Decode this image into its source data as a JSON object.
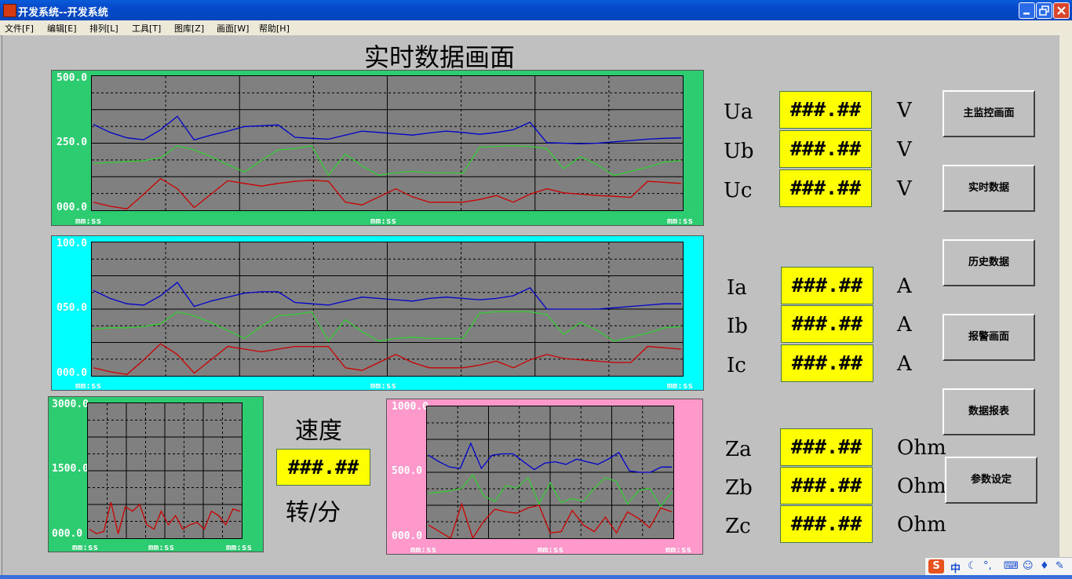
{
  "window": {
    "title": "开发系统--开发系统"
  },
  "menu": {
    "items": [
      "文件[F]",
      "编辑[E]",
      "排列[L]",
      "工具[T]",
      "图库[Z]",
      "画面[W]",
      "帮助[H]"
    ]
  },
  "screen_title": "实时数据画面",
  "colors": {
    "panel_green": "#2ecc71",
    "panel_cyan": "#00ffff",
    "panel_pink": "#ff99cc",
    "plot_bg": "#808080",
    "value_bg": "#ffff00",
    "series_blue": "#0000cc",
    "series_green": "#33cc33",
    "series_red": "#cc0000"
  },
  "chart_data": [
    {
      "type": "line",
      "ylim": [
        0,
        500
      ],
      "y_ticks": [
        "500.0",
        "250.0",
        "000.0"
      ],
      "x_ticks": [
        "mm:ss",
        "mm:ss",
        "mm:ss"
      ],
      "series": [
        {
          "color": "#0000cc",
          "values": [
            320,
            290,
            270,
            263,
            300,
            350,
            262,
            280,
            295,
            312,
            315,
            318,
            272,
            268,
            265,
            280,
            295,
            290,
            285,
            280,
            288,
            295,
            290,
            283,
            290,
            300,
            328,
            252,
            250,
            248,
            250,
            255,
            260,
            265,
            268,
            270
          ]
        },
        {
          "color": "#33cc33",
          "values": [
            175,
            178,
            182,
            185,
            195,
            240,
            225,
            200,
            170,
            142,
            185,
            225,
            230,
            240,
            130,
            210,
            165,
            130,
            140,
            145,
            140,
            140,
            138,
            235,
            238,
            240,
            238,
            230,
            155,
            200,
            170,
            130,
            145,
            160,
            180,
            185
          ]
        },
        {
          "color": "#cc0000",
          "values": [
            30,
            15,
            5,
            60,
            118,
            80,
            10,
            60,
            110,
            100,
            90,
            100,
            108,
            112,
            108,
            30,
            20,
            50,
            80,
            50,
            30,
            30,
            30,
            40,
            55,
            30,
            60,
            80,
            65,
            60,
            55,
            52,
            48,
            108,
            104,
            100
          ]
        }
      ]
    },
    {
      "type": "line",
      "ylim": [
        0,
        100
      ],
      "y_ticks": [
        "100.0",
        "050.0",
        "000.0"
      ],
      "x_ticks": [
        "mm:ss",
        "mm:ss",
        "mm:ss"
      ],
      "series": [
        {
          "color": "#0000cc",
          "values": [
            64,
            58,
            54,
            53,
            60,
            70,
            52,
            56,
            59,
            62,
            63,
            63,
            55,
            54,
            53,
            56,
            59,
            58,
            57,
            56,
            58,
            59,
            58,
            57,
            58,
            60,
            66,
            50,
            50,
            50,
            50,
            51,
            52,
            53,
            54,
            54
          ]
        },
        {
          "color": "#33cc33",
          "values": [
            35,
            36,
            36,
            37,
            39,
            48,
            45,
            40,
            34,
            28,
            37,
            45,
            46,
            48,
            26,
            42,
            33,
            26,
            28,
            29,
            28,
            28,
            28,
            47,
            48,
            48,
            48,
            46,
            31,
            40,
            34,
            26,
            29,
            32,
            36,
            37
          ]
        },
        {
          "color": "#cc0000",
          "values": [
            6,
            3,
            1,
            12,
            24,
            16,
            2,
            12,
            22,
            20,
            18,
            20,
            22,
            22,
            22,
            6,
            4,
            10,
            16,
            10,
            6,
            6,
            6,
            8,
            11,
            6,
            12,
            16,
            13,
            12,
            11,
            10,
            10,
            22,
            21,
            20
          ]
        }
      ]
    },
    {
      "type": "line",
      "ylim": [
        0,
        3000
      ],
      "y_ticks": [
        "3000.0",
        "1500.0",
        "000.0"
      ],
      "x_ticks": [
        "mm:ss",
        "mm:ss",
        "mm:ss"
      ],
      "series": [
        {
          "color": "#cc0000",
          "values": [
            200,
            100,
            150,
            800,
            100,
            700,
            600,
            750,
            300,
            200,
            600,
            300,
            500,
            200,
            300,
            350,
            200,
            600,
            500,
            300,
            650,
            600
          ]
        }
      ]
    },
    {
      "type": "line",
      "ylim": [
        0,
        1000
      ],
      "y_ticks": [
        "1000.0",
        "500.0",
        "000.0"
      ],
      "x_ticks": [
        "mm:ss",
        "mm:ss",
        "mm:ss"
      ],
      "series": [
        {
          "color": "#0000cc",
          "values": [
            630,
            580,
            540,
            530,
            720,
            530,
            630,
            640,
            640,
            580,
            520,
            570,
            580,
            560,
            600,
            580,
            560,
            600,
            650,
            510,
            500,
            500,
            540,
            540
          ]
        },
        {
          "color": "#33cc33",
          "values": [
            340,
            350,
            360,
            380,
            480,
            320,
            280,
            400,
            380,
            460,
            260,
            420,
            270,
            300,
            280,
            380,
            460,
            430,
            260,
            360,
            380,
            240,
            350
          ]
        },
        {
          "color": "#cc0000",
          "values": [
            100,
            50,
            0,
            260,
            0,
            130,
            220,
            200,
            190,
            230,
            250,
            40,
            50,
            210,
            100,
            50,
            160,
            40,
            200,
            150,
            80,
            230,
            200
          ]
        }
      ]
    }
  ],
  "voltage": {
    "labels": [
      "Ua",
      "Ub",
      "Uc"
    ],
    "values": [
      "###.##",
      "###.##",
      "###.##"
    ],
    "unit": "V"
  },
  "current": {
    "labels": [
      "Ia",
      "Ib",
      "Ic"
    ],
    "values": [
      "###.##",
      "###.##",
      "###.##"
    ],
    "unit": "A"
  },
  "impedance": {
    "labels": [
      "Za",
      "Zb",
      "Zc"
    ],
    "values": [
      "###.##",
      "###.##",
      "###.##"
    ],
    "unit": "Ohm"
  },
  "speed": {
    "label": "速度",
    "value": "###.##",
    "unit": "转/分"
  },
  "nav": {
    "buttons": [
      "主监控画面",
      "实时数据",
      "历史数据",
      "报警画面",
      "数据报表",
      "参数设定"
    ]
  },
  "tray": {
    "ime_lang": "中"
  }
}
